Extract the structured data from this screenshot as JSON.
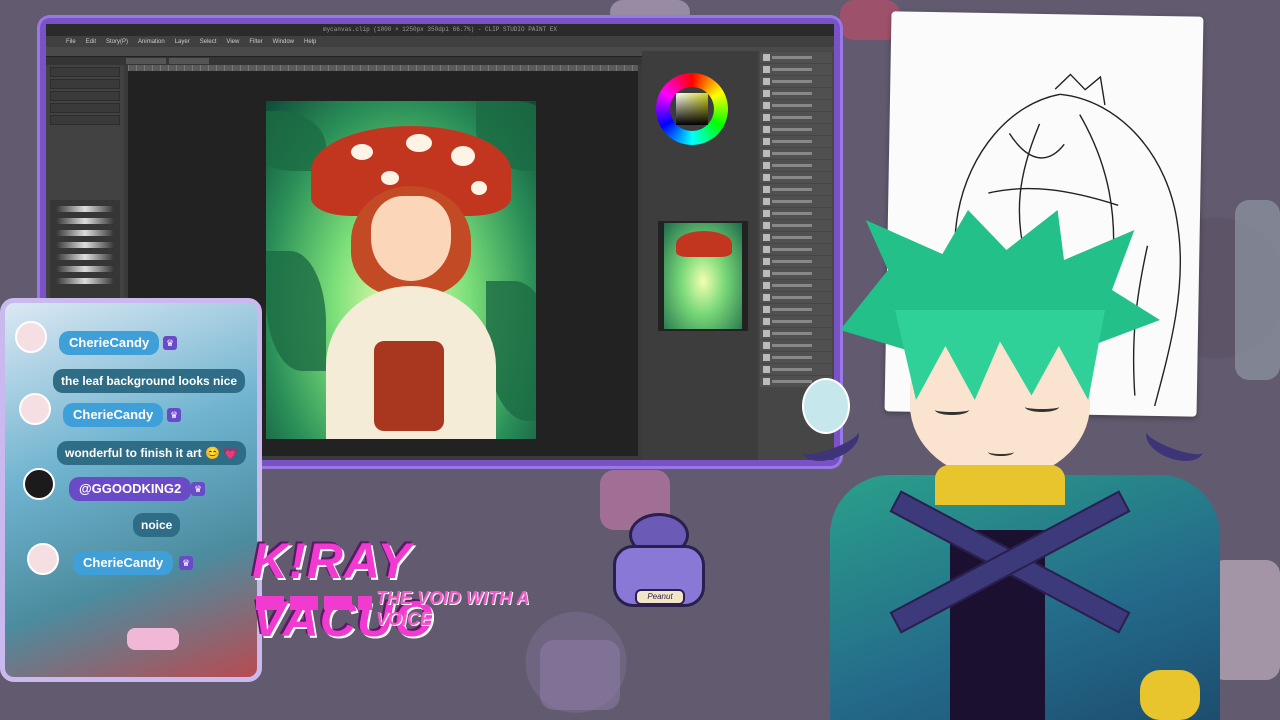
{
  "app": {
    "title": "mycanvas.clip (1000 × 1250px 350dpi 66.7%)  - CLIP STUDIO PAINT EX",
    "menu": [
      "File",
      "Edit",
      "Story(P)",
      "Animation",
      "Layer",
      "Select",
      "View",
      "Filter",
      "Window",
      "Help"
    ]
  },
  "chat": {
    "messages": [
      {
        "user": "CherieCandy",
        "text": "the leaf background looks nice"
      },
      {
        "user": "CherieCandy",
        "text": "wonderful to finish it art 😊 💗"
      },
      {
        "user": "@GGOODKING2",
        "text": "noice"
      },
      {
        "user": "CherieCandy",
        "text": ""
      }
    ]
  },
  "logo": {
    "title": "K!RAY VACUO",
    "subtitle": "THE VOID WITH A VOICE"
  },
  "mascot": {
    "plate": "Peanut"
  },
  "colors": {
    "accent": "#7a52c8",
    "chat_name": "#3f9fd8",
    "logo_pink": "#f13bd0",
    "avatar_hair": "#24c08a"
  }
}
